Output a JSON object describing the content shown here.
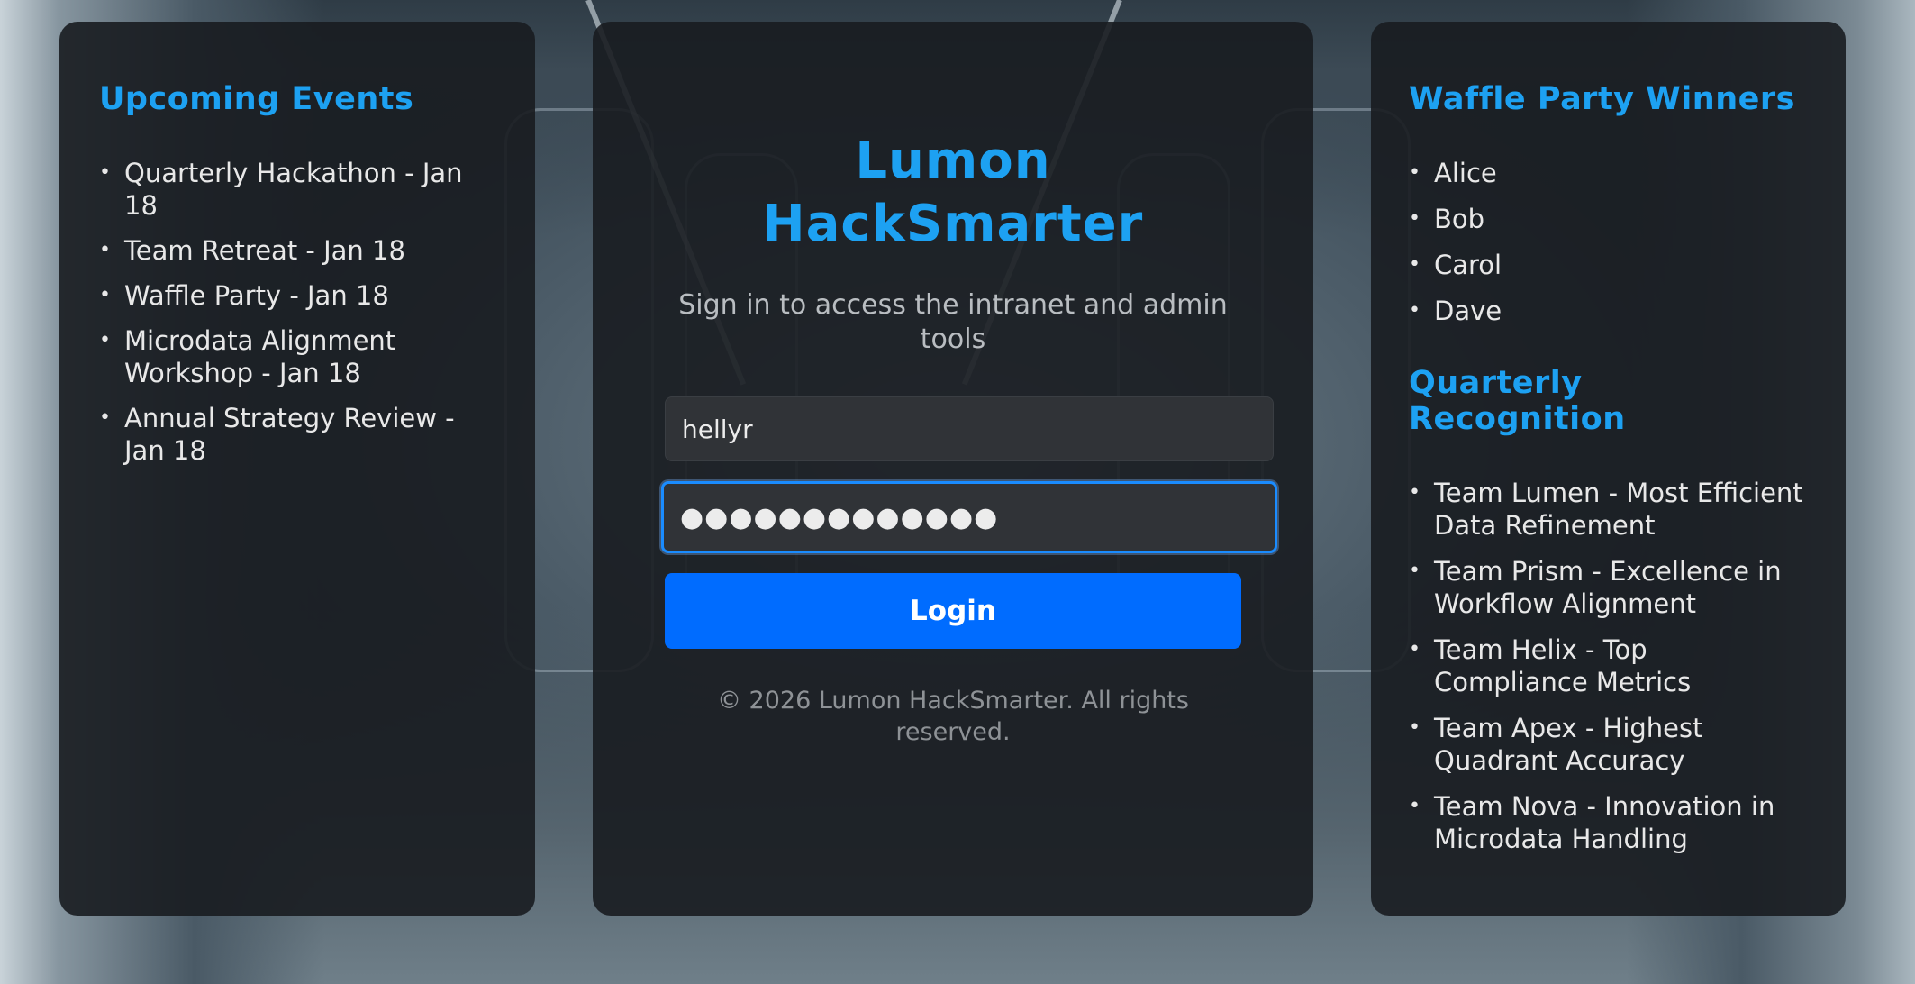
{
  "left_panel": {
    "title": "Upcoming Events",
    "items": [
      "Quarterly Hackathon - Jan 18",
      "Team Retreat - Jan 18",
      "Waffle Party - Jan 18",
      "Microdata Alignment Workshop - Jan 18",
      "Annual Strategy Review - Jan 18"
    ]
  },
  "login": {
    "title": "Lumon HackSmarter",
    "subtitle": "Sign in to access the intranet and admin tools",
    "username_value": "hellyr",
    "password_value": "●●●●●●●●●●●●●",
    "button_label": "Login",
    "footer": "© 2026 Lumon HackSmarter. All rights reserved.",
    "accent_color": "#1da1f2",
    "button_color": "#006cff"
  },
  "right_panel": {
    "winners_title": "Waffle Party Winners",
    "winners": [
      "Alice",
      "Bob",
      "Carol",
      "Dave"
    ],
    "recognition_title": "Quarterly Recognition",
    "recognition": [
      "Team Lumen - Most Efficient Data Refinement",
      "Team Prism - Excellence in Workflow Alignment",
      "Team Helix - Top Compliance Metrics",
      "Team Apex - Highest Quadrant Accuracy",
      "Team Nova - Innovation in Microdata Handling"
    ]
  },
  "bullet": "•"
}
